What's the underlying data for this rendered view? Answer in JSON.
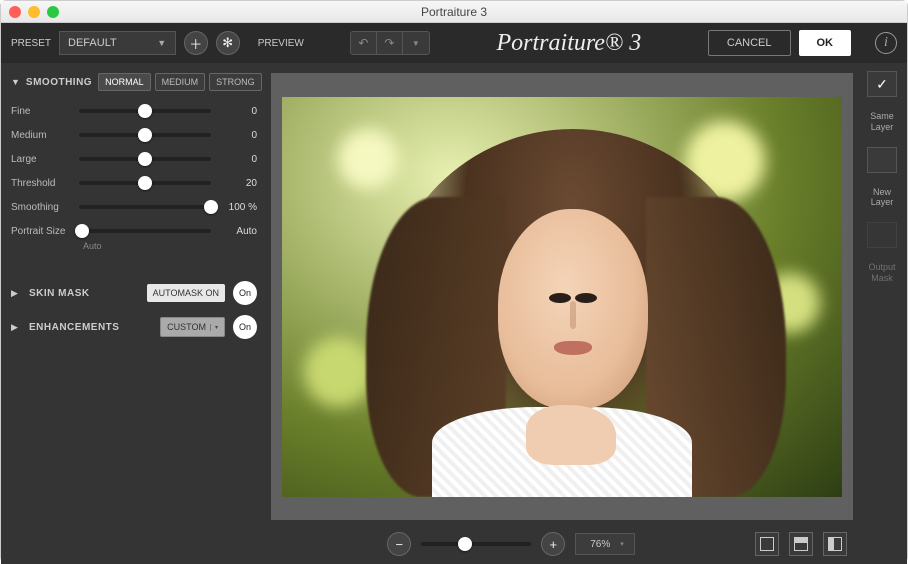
{
  "window": {
    "title": "Portraiture 3"
  },
  "header": {
    "preset_label": "PRESET",
    "preset_value": "DEFAULT",
    "preview_label": "PREVIEW",
    "brand": "Portraiture® 3",
    "cancel": "CANCEL",
    "ok": "OK"
  },
  "smoothing": {
    "title": "SMOOTHING",
    "strength": {
      "normal": "NORMAL",
      "medium": "MEDIUM",
      "strong": "STRONG"
    },
    "rows": {
      "fine": {
        "label": "Fine",
        "value": "0",
        "pos": 0.5
      },
      "medium": {
        "label": "Medium",
        "value": "0",
        "pos": 0.5
      },
      "large": {
        "label": "Large",
        "value": "0",
        "pos": 0.5
      },
      "threshold": {
        "label": "Threshold",
        "value": "20",
        "pos": 0.5
      },
      "smooth": {
        "label": "Smoothing",
        "value": "100  %",
        "pos": 1.0
      },
      "psize": {
        "label": "Portrait Size",
        "value": "Auto",
        "pos": 0.02
      }
    },
    "psize_sub": "Auto"
  },
  "skinmask": {
    "title": "SKIN MASK",
    "automask": "AUTOMASK ON",
    "on": "On"
  },
  "enhance": {
    "title": "ENHANCEMENTS",
    "custom": "CUSTOM",
    "on": "On"
  },
  "zoom": {
    "value": "76%"
  },
  "right": {
    "same": "Same\nLayer",
    "new": "New\nLayer",
    "output": "Output\nMask"
  }
}
